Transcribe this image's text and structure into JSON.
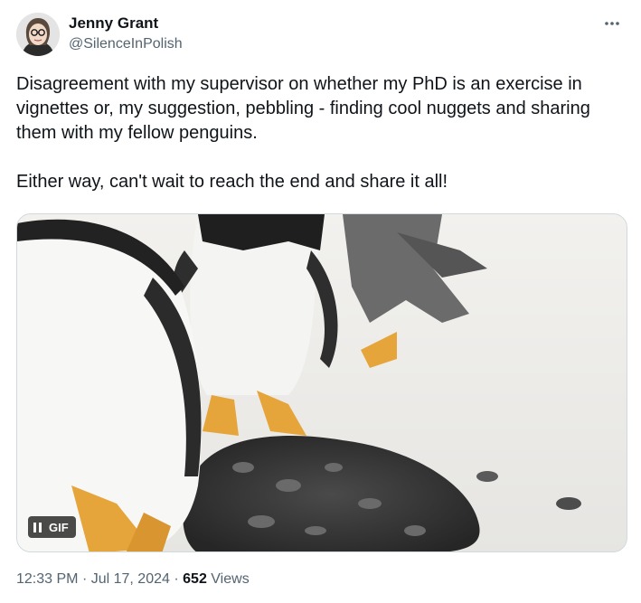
{
  "author": {
    "display_name": "Jenny Grant",
    "handle": "@SilenceInPolish"
  },
  "more_icon": "more-horizontal-icon",
  "tweet": {
    "paragraphs": [
      "Disagreement with my supervisor on whether my PhD is an exercise in vignettes or, my suggestion, pebbling - finding cool nuggets and sharing them with my fellow penguins.",
      "Either way, can't wait to reach the end and share it all!"
    ]
  },
  "media": {
    "badge_label": "GIF",
    "badge_icon": "pause-icon"
  },
  "meta": {
    "time": "12:33 PM",
    "separator": "·",
    "date": "Jul 17, 2024",
    "views_count": "652",
    "views_label": "Views"
  },
  "colors": {
    "text_primary": "#0f1419",
    "text_secondary": "#536471",
    "border": "#cfd9de"
  }
}
